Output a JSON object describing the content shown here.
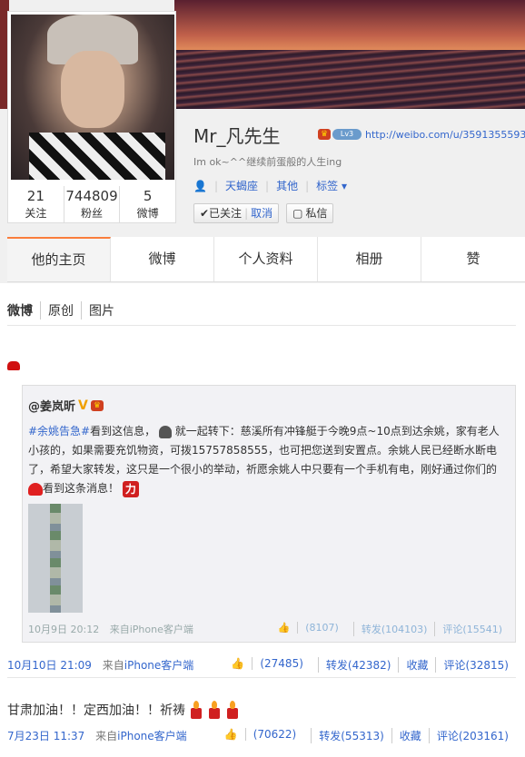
{
  "profile": {
    "name": "Mr_凡先生",
    "url": "http://weibo.com/u/3591355593",
    "bio": "Im ok~^^继续前蛋般的人生ing",
    "constellation": "天蝎座",
    "other": "其他",
    "tags_label": "标签",
    "level_badge": "Lv3",
    "stats": [
      {
        "num": "21",
        "label": "关注"
      },
      {
        "num": "744809",
        "label": "粉丝"
      },
      {
        "num": "5",
        "label": "微博"
      }
    ],
    "followed_label": "✔已关注",
    "cancel_label": "取消",
    "message_label": "私信"
  },
  "tabs": [
    "他的主页",
    "微博",
    "个人资料",
    "相册",
    "赞"
  ],
  "subtabs": [
    "微博",
    "原创",
    "图片"
  ],
  "repost": {
    "user": "@姜岚昕",
    "tag": "#余姚告急#",
    "text_1": "看到这信息，",
    "text_2": "就一起转下：慈溪所有冲锋艇于今晚9点~10点到达余姚，家有老人小孩的，如果需要充饥物资，可拨15757858555，也可把您送到安置点。余姚人民已经断水断电了，希望大家转发，这只是一个很小的举动，祈愿余姚人中只要有一个手机有电，刚好通过你们的",
    "text_3": "看到这条消息！",
    "time": "10月9日 20:12",
    "source_prefix": "来自",
    "source": "iPhone客户端",
    "likes": "(8107)",
    "reposts": "转发(104103)",
    "comments": "评论(15541)"
  },
  "post1": {
    "time": "10月10日 21:09",
    "source_prefix": "来自",
    "source": "iPhone客户端",
    "likes": "(27485)",
    "reposts": "转发(42382)",
    "favorite": "收藏",
    "comments": "评论(32815)"
  },
  "post2": {
    "text": "甘肃加油！！定西加油！！祈祷",
    "time": "7月23日 11:37",
    "source_prefix": "来自",
    "source": "iPhone客户端",
    "likes": "(70622)",
    "reposts": "转发(55313)",
    "favorite": "收藏",
    "comments": "评论(203161)"
  },
  "colors": {
    "accent": "#fa7d3c",
    "link": "#3366cc"
  }
}
